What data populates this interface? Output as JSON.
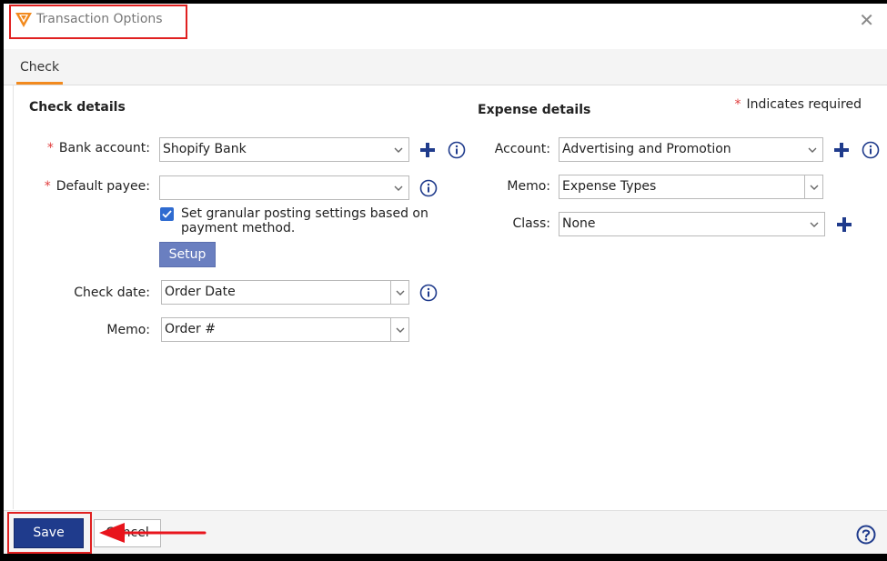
{
  "dialog": {
    "title": "Transaction Options",
    "tab": "Check",
    "required_note": "Indicates required",
    "required_mark": "*"
  },
  "check_details": {
    "title": "Check details",
    "bank_account_label": "Bank account:",
    "bank_account_value": "Shopify Bank",
    "default_payee_label": "Default payee:",
    "default_payee_value": "",
    "granular_checkbox_label": "Set granular posting settings based on payment method.",
    "granular_checked": true,
    "setup_label": "Setup",
    "check_date_label": "Check date:",
    "check_date_value": "Order Date",
    "memo_label": "Memo:",
    "memo_value": "Order #"
  },
  "expense_details": {
    "title": "Expense details",
    "account_label": "Account:",
    "account_value": "Advertising and Promotion",
    "memo_label": "Memo:",
    "memo_value": "Expense Types",
    "class_label": "Class:",
    "class_value": "None"
  },
  "footer": {
    "save_label": "Save",
    "cancel_label": "Cancel"
  },
  "colors": {
    "accent_orange": "#f28a1e",
    "plus_blue": "#1f3b8c",
    "highlight_red": "#e02020",
    "checkbox_blue": "#2f6bd0"
  },
  "icons": [
    "app-logo-icon",
    "close-icon",
    "plus-icon",
    "info-icon",
    "chevron-down-icon",
    "help-icon",
    "arrow-left-icon"
  ]
}
